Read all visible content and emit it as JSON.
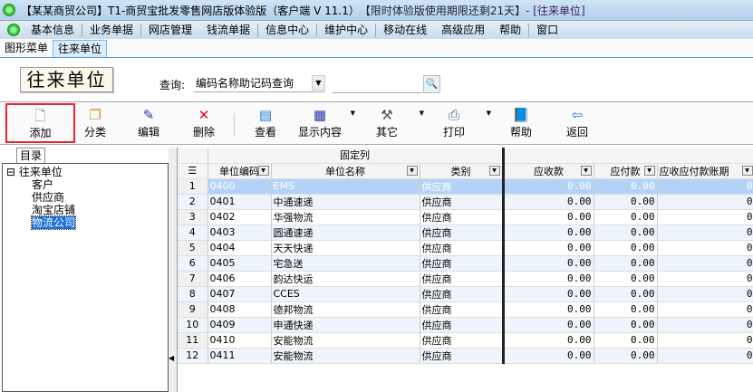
{
  "title": {
    "company": "【某某商贸公司】",
    "app": "T1-商贸宝批发零售网店版体验版（客户端 V 11.1）",
    "trial": "【限时体验版使用期限还剩21天】",
    "window": " - [往来单位]"
  },
  "menu": [
    "基本信息",
    "业务单据",
    "网店管理",
    "钱流单据",
    "信息中心",
    "维护中心",
    "移动在线",
    "高级应用",
    "帮助",
    "窗口"
  ],
  "tabs": [
    "图形菜单",
    "往来单位"
  ],
  "stamp": "往来单位",
  "query": {
    "label": "查询:",
    "selected": "编码名称助记码查询",
    "value": ""
  },
  "toolbar": [
    {
      "label": "添加",
      "icon": "document-icon"
    },
    {
      "label": "分类",
      "icon": "copy-icon"
    },
    {
      "label": "编辑",
      "icon": "pen-icon"
    },
    {
      "label": "删除",
      "icon": "delete-icon"
    },
    {
      "label": "查看",
      "icon": "view-icon"
    },
    {
      "label": "显示内容",
      "icon": "grid-icon"
    },
    {
      "label": "其它",
      "icon": "hammer-icon"
    },
    {
      "label": "打印",
      "icon": "printer-icon"
    },
    {
      "label": "帮助",
      "icon": "book-icon"
    },
    {
      "label": "返回",
      "icon": "exit-icon"
    }
  ],
  "tree": {
    "tab": "目录",
    "root": "往来单位",
    "children": [
      "客户",
      "供应商",
      "淘宝店铺",
      "物流公司"
    ],
    "selected": "物流公司"
  },
  "grid": {
    "group": "固定列",
    "columns": [
      "单位编码",
      "单位名称",
      "类别",
      "应收款",
      "应付款",
      "应收应付款账期"
    ],
    "rows": [
      [
        "1",
        "0400",
        "EMS",
        "供应商",
        "0.00",
        "0.00",
        "0"
      ],
      [
        "2",
        "0401",
        "中通速递",
        "供应商",
        "0.00",
        "0.00",
        "0"
      ],
      [
        "3",
        "0402",
        "华强物流",
        "供应商",
        "0.00",
        "0.00",
        "0"
      ],
      [
        "4",
        "0403",
        "圆通速递",
        "供应商",
        "0.00",
        "0.00",
        "0"
      ],
      [
        "5",
        "0404",
        "天天快递",
        "供应商",
        "0.00",
        "0.00",
        "0"
      ],
      [
        "6",
        "0405",
        "宅急送",
        "供应商",
        "0.00",
        "0.00",
        "0"
      ],
      [
        "7",
        "0406",
        "韵达快运",
        "供应商",
        "0.00",
        "0.00",
        "0"
      ],
      [
        "8",
        "0407",
        "CCES",
        "供应商",
        "0.00",
        "0.00",
        "0"
      ],
      [
        "9",
        "0408",
        "德邦物流",
        "供应商",
        "0.00",
        "0.00",
        "0"
      ],
      [
        "10",
        "0409",
        "申通快递",
        "供应商",
        "0.00",
        "0.00",
        "0"
      ],
      [
        "11",
        "0410",
        "安能物流",
        "供应商",
        "0.00",
        "0.00",
        "0"
      ],
      [
        "12",
        "0411",
        "安能物流",
        "供应商",
        "0.00",
        "0.00",
        "0"
      ]
    ]
  }
}
